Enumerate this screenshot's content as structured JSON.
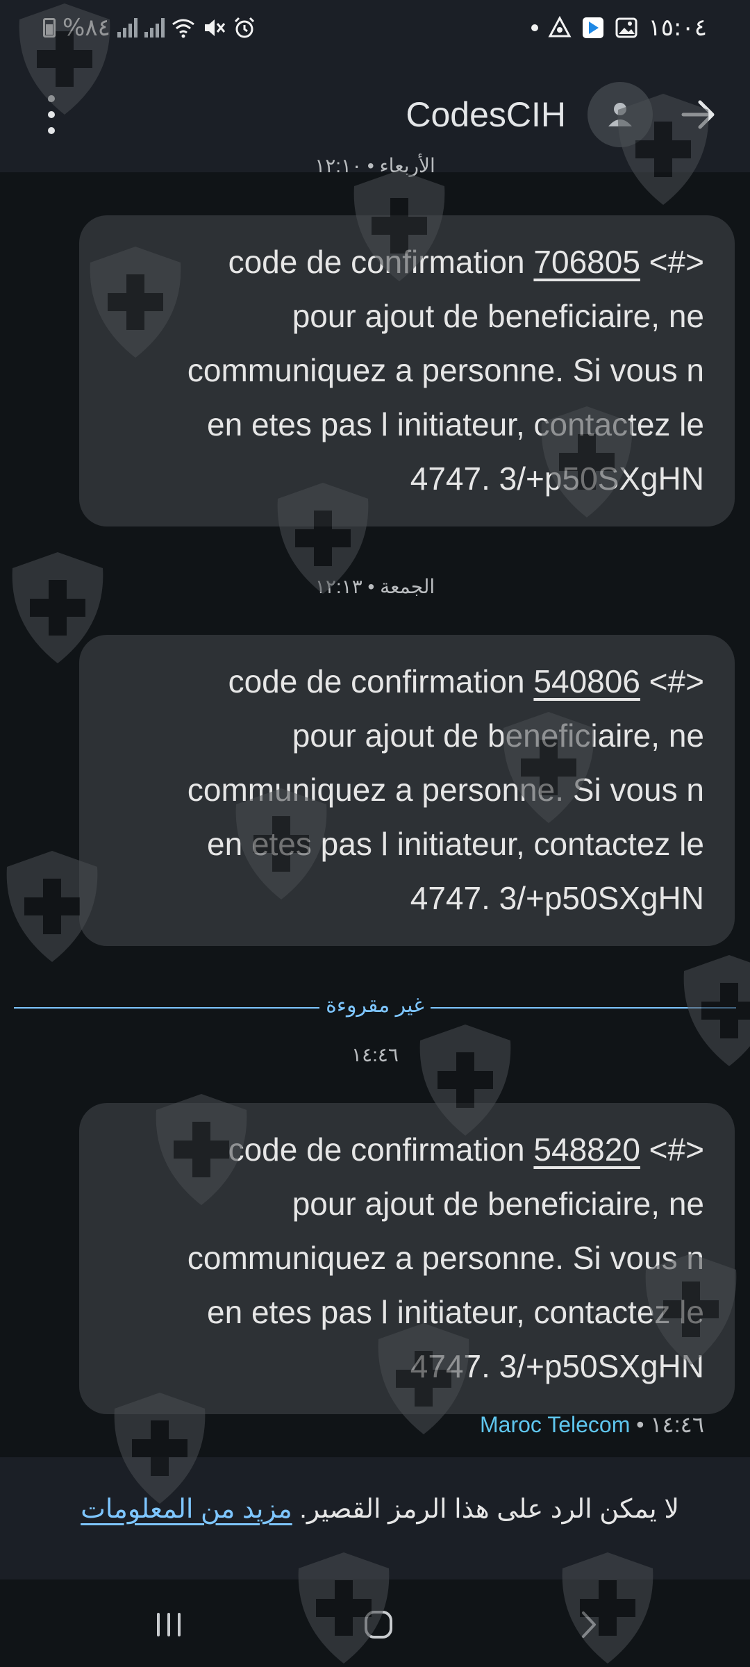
{
  "status_bar": {
    "battery": "%٨٤",
    "time": "١٥:٠٤"
  },
  "app_bar": {
    "title": "CodesCIH"
  },
  "messages": [
    {
      "line1_prefix": "code de confirmation ",
      "code": "706805",
      "line1_suffix": " <#>",
      "lines": [
        "pour ajout de beneficiaire, ne",
        "communiquez a personne. Si vous n",
        "en etes pas l initiateur, contactez le",
        "4747. 3/+p50SXgHN"
      ]
    },
    {
      "line1_prefix": "code de confirmation ",
      "code": "540806",
      "line1_suffix": " <#>",
      "lines": [
        "pour ajout de beneficiaire, ne",
        "communiquez a personne. Si vous n",
        "en etes pas l initiateur, contactez le",
        "4747. 3/+p50SXgHN"
      ]
    },
    {
      "line1_prefix": "code de confirmation ",
      "code": "548820",
      "line1_suffix": " <#>",
      "lines": [
        "pour ajout de beneficiaire, ne",
        "communiquez a personne. Si vous n",
        "en etes pas l initiateur, contactez le",
        "4747. 3/+p50SXgHN"
      ]
    }
  ],
  "timestamps": {
    "partial_top": "الأربعاء • ١٢:١٠",
    "friday": "الجمعة • ١٢:١٣",
    "unread_time": "١٤:٤٦"
  },
  "unread_divider": "غير مقروءة",
  "sender": {
    "name": "Maroc Telecom",
    "sep": " • ",
    "time": "١٤:٤٦"
  },
  "reply_info": {
    "text": "لا يمكن الرد على هذا الرمز القصير. ",
    "link": "مزيد من المعلومات"
  },
  "colors": {
    "accent": "#7ec6ff",
    "sender": "#5fc6ee",
    "bubble": "#2d3135",
    "background": "#101417"
  },
  "icons": [
    "menu-icon",
    "person-icon",
    "arrow-forward-icon",
    "recents-icon",
    "home-icon",
    "back-icon",
    "shield-cross-watermark"
  ]
}
